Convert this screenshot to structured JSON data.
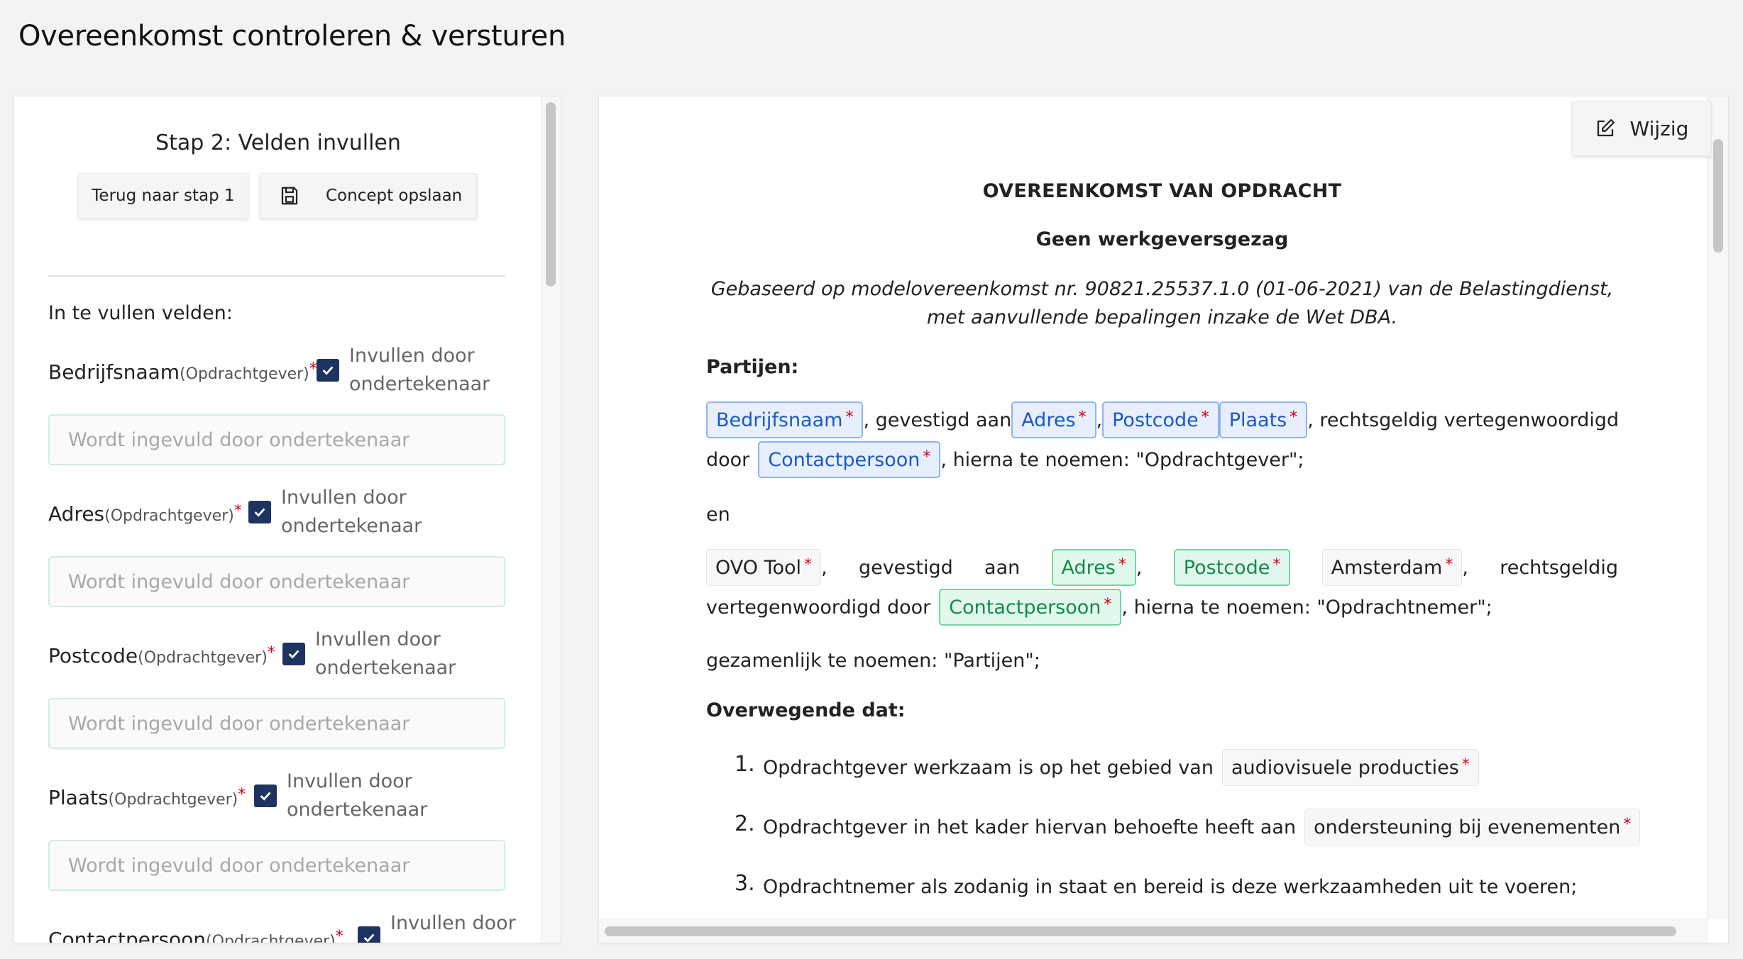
{
  "page_title": "Overeenkomst controleren & versturen",
  "left": {
    "step_title": "Stap 2: Velden invullen",
    "back_button": "Terug naar stap 1",
    "save_button": "Concept opslaan",
    "fields_heading": "In te vullen velden:",
    "fields": [
      {
        "label": "Bedrijfsnaam",
        "sub": "(Opdrachtgever)",
        "req": "*",
        "checkbox_label": "Invullen door ondertekenaar",
        "placeholder": "Wordt ingevuld door ondertekenaar"
      },
      {
        "label": "Adres",
        "sub": "(Opdrachtgever)",
        "req": "*",
        "checkbox_label": "Invullen door ondertekenaar",
        "placeholder": "Wordt ingevuld door ondertekenaar"
      },
      {
        "label": "Postcode",
        "sub": "(Opdrachtgever)",
        "req": "*",
        "checkbox_label": "Invullen door ondertekenaar",
        "placeholder": "Wordt ingevuld door ondertekenaar"
      },
      {
        "label": "Plaats",
        "sub": "(Opdrachtgever)",
        "req": "*",
        "checkbox_label": "Invullen door ondertekenaar",
        "placeholder": "Wordt ingevuld door ondertekenaar"
      },
      {
        "label": "Contactpersoon",
        "sub": "(Opdrachtgever)",
        "req": "*",
        "checkbox_label": "Invullen door",
        "placeholder": ""
      }
    ]
  },
  "right": {
    "edit_button": "Wijzig",
    "doc": {
      "title": "OVEREENKOMST VAN OPDRACHT",
      "subtitle": "Geen werkgeversgezag",
      "basis": "Gebaseerd op modelovereenkomst nr. 90821.25537.1.0 (01-06-2021) van de Belastingdienst, met aanvullende bepalingen inzake de Wet DBA.",
      "parties_heading": "Partijen:",
      "party1": {
        "company": "Bedrijfsnaam",
        "t1": ", gevestigd aan",
        "address": "Adres",
        "comma": ",",
        "postcode": "Postcode",
        "city": "Plaats",
        "t2": ", rechtsgeldig vertegenwoordigd",
        "t3": "door",
        "contact": "Contactpersoon",
        "t4": ", hierna te noemen: \"Opdrachtgever\";"
      },
      "and": "en",
      "party2": {
        "company": "OVO Tool",
        "comma": ",",
        "t1a": "gevestigd",
        "t1b": "aan",
        "address": "Adres",
        "postcode": "Postcode",
        "city": "Amsterdam",
        "t2": "rechtsgeldig",
        "t3": "vertegenwoordigd door",
        "contact": "Contactpersoon",
        "t4": ", hierna te noemen: \"Opdrachtnemer\";"
      },
      "together": "gezamenlijk te noemen: \"Partijen\";",
      "considering_heading": "Overwegende dat:",
      "req_mark": "*",
      "items": [
        {
          "num": "1.",
          "text": "Opdrachtgever werkzaam is op het gebied van",
          "tag": "audiovisuele producties"
        },
        {
          "num": "2.",
          "text": "Opdrachtgever in het kader hiervan behoefte heeft aan",
          "tag": "ondersteuning bij evenementen"
        },
        {
          "num": "3.",
          "text": "Opdrachtnemer als zodanig in staat en bereid is deze werkzaamheden uit te voeren;",
          "tag": ""
        }
      ]
    }
  },
  "colors": {
    "checkbox": "#1d3461",
    "tag_blue": "#1a59c7",
    "tag_green": "#138a4a",
    "required": "#d0021b",
    "input_border": "#cdeee0"
  }
}
